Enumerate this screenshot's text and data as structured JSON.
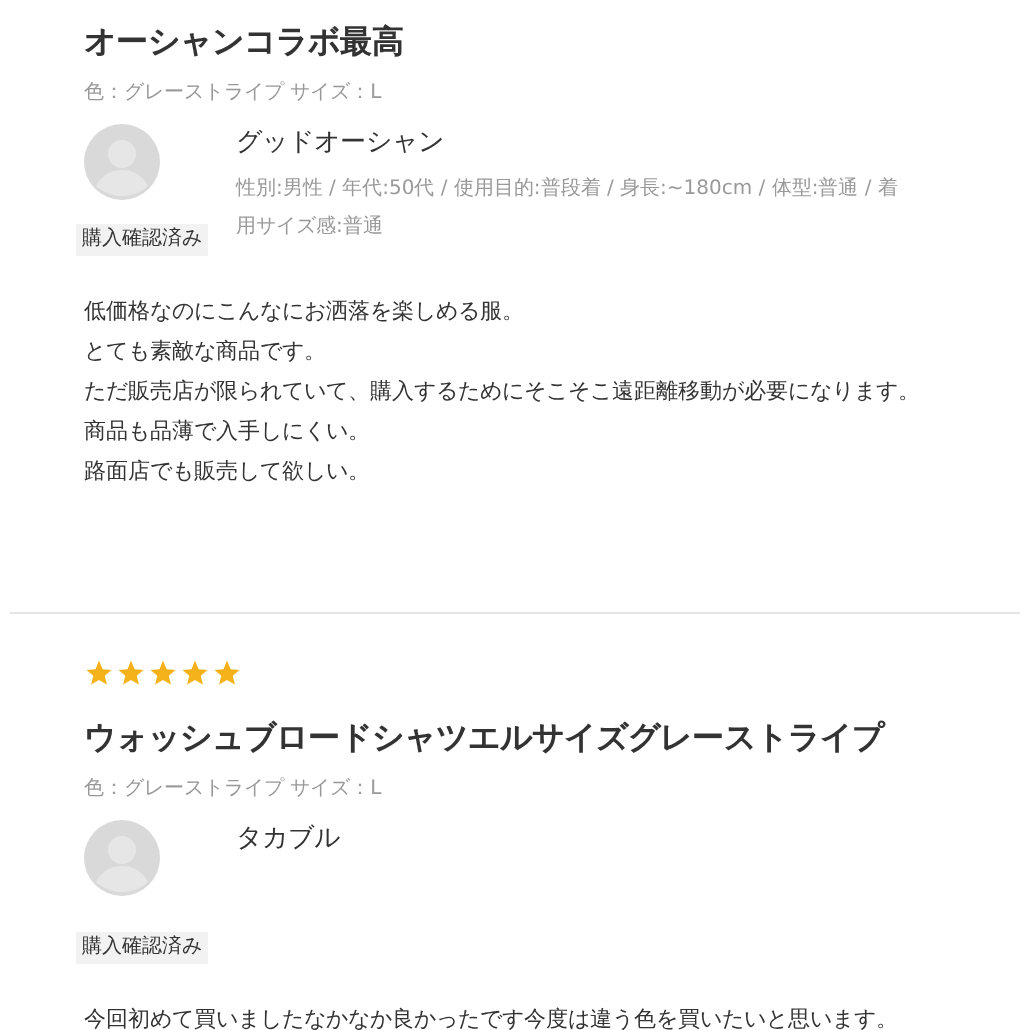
{
  "reviews": [
    {
      "title": "オーシャンコラボ最高",
      "variant": "色：グレーストライプ サイズ：L",
      "reviewer": "グッドオーシャン",
      "attributes": "性別:男性 / 年代:50代 / 使用目的:普段着 / 身長:~180cm / 体型:普通 / 着用サイズ感:普通",
      "badge": "購入確認済み",
      "body": [
        "低価格なのにこんなにお洒落を楽しめる服。",
        "とても素敵な商品です。",
        "ただ販売店が限られていて、購入するためにそこそこ遠距離移動が必要になります。",
        "商品も品薄で入手しにくい。",
        "路面店でも販売して欲しい。"
      ]
    },
    {
      "stars": 5,
      "title": "ウォッシュブロードシャツエルサイズグレーストライプ",
      "variant": "色：グレーストライプ サイズ：L",
      "reviewer": "タカブル",
      "badge": "購入確認済み",
      "body": [
        "今回初めて買いましたなかなか良かったです今度は違う色を買いたいと思います。"
      ]
    }
  ]
}
